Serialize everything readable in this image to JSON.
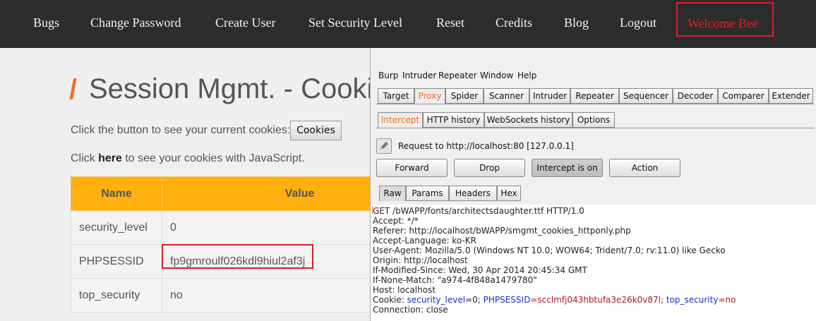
{
  "nav": {
    "items": [
      "Bugs",
      "Change Password",
      "Create User",
      "Set Security Level",
      "Reset",
      "Credits",
      "Blog",
      "Logout"
    ],
    "welcome": "Welcome Bee"
  },
  "page": {
    "slash": "/",
    "title": "Session Mgmt. - Cooki",
    "line1": "Click the button to see your current cookies:",
    "cookies_button": "Cookies",
    "line2_pre": "Click ",
    "line2_link": "here",
    "line2_post": " to see your cookies with JavaScript.",
    "table": {
      "headers": [
        "Name",
        "Value"
      ],
      "rows": [
        {
          "name": "security_level",
          "value": "0"
        },
        {
          "name": "PHPSESSID",
          "value": "fp9gmroulf026kdl9hiul2af3j"
        },
        {
          "name": "top_security",
          "value": "no"
        }
      ]
    }
  },
  "burp": {
    "menu": [
      "Burp",
      "Intruder",
      "Repeater",
      "Window",
      "Help"
    ],
    "tools": [
      "Target",
      "Proxy",
      "Spider",
      "Scanner",
      "Intruder",
      "Repeater",
      "Sequencer",
      "Decoder",
      "Comparer",
      "Extender"
    ],
    "proxy_tabs": [
      "Intercept",
      "HTTP history",
      "WebSockets history",
      "Options"
    ],
    "request_label": "Request to http://localhost:80  [127.0.0.1]",
    "buttons": [
      "Forward",
      "Drop",
      "Intercept is on",
      "Action"
    ],
    "view_tabs": [
      "Raw",
      "Params",
      "Headers",
      "Hex"
    ],
    "raw": {
      "l1": "GET /bWAPP/fonts/architectsdaughter.ttf HTTP/1.0",
      "l2": "Accept: */*",
      "l3": "Referer: http://localhost/bWAPP/smgmt_cookies_httponly.php",
      "l4": "Accept-Language: ko-KR",
      "l5": "User-Agent: Mozilla/5.0 (Windows NT 10.0; WOW64; Trident/7.0; rv:11.0) like Gecko",
      "l6": "Origin: http://localhost",
      "l7": "If-Modified-Since: Wed, 30 Apr 2014 20:45:34 GMT",
      "l8": "If-None-Match: \"a974-4f848a1479780\"",
      "l9": "Host: localhost",
      "cookie": {
        "prefix": "Cookie: ",
        "k1": "security_level",
        "v1": "=0; ",
        "k2": "PHPSESSID",
        "v2": "=scclmfj043hbtufa3e26k0v87l; ",
        "k3": "top_security",
        "v3": "=no"
      },
      "l11": "Connection: close"
    }
  },
  "colors": {
    "accent": "#f36f21",
    "highlight_box": "#d6202a",
    "table_header": "#ffb00f",
    "cookie_key": "#1a2ec0",
    "cookie_val": "#b0161e"
  }
}
